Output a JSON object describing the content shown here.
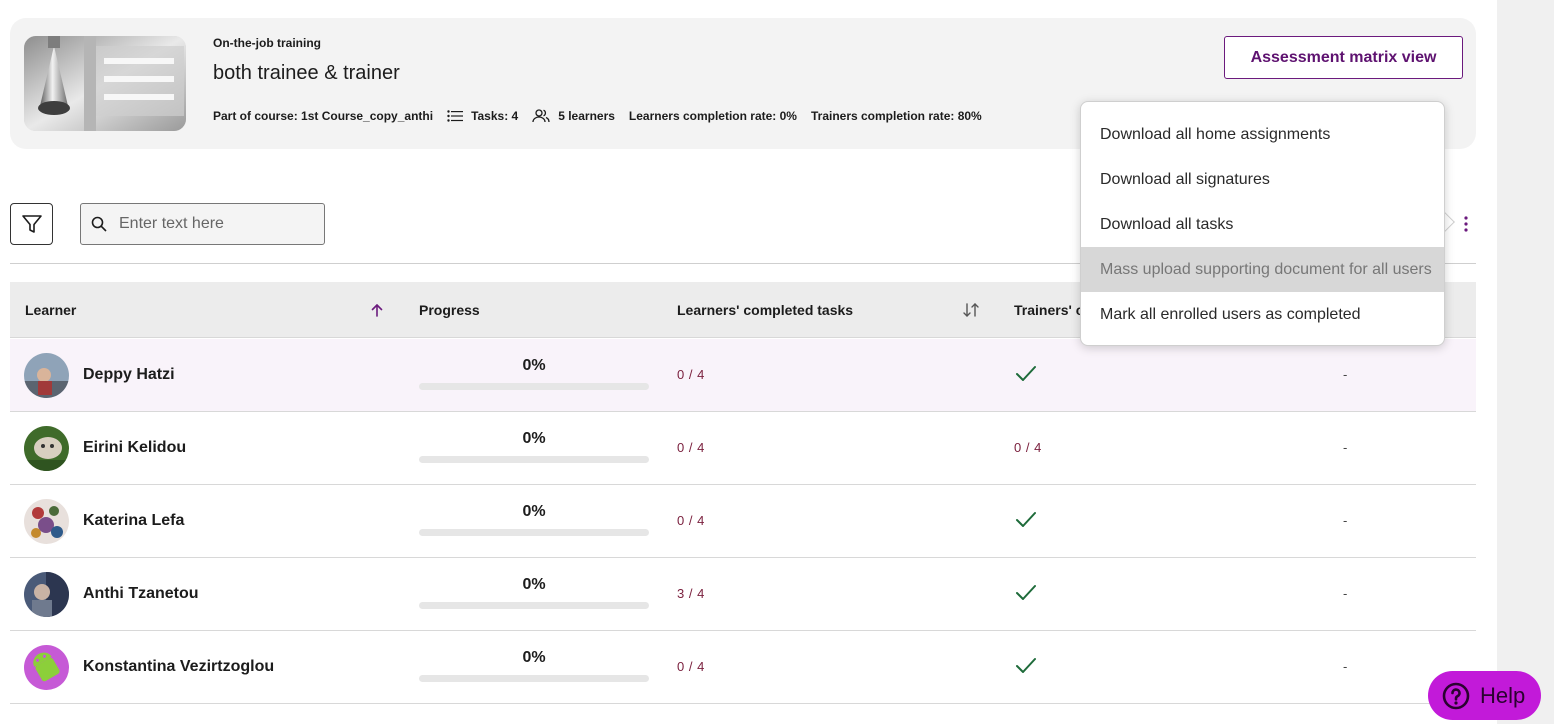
{
  "header": {
    "kicker": "On-the-job training",
    "title": "both trainee & trainer",
    "meta": {
      "course": "Part of course: 1st Course_copy_anthi",
      "tasks": "Tasks: 4",
      "learners": "5 learners",
      "learners_rate": "Learners completion rate: 0%",
      "trainers_rate": "Trainers completion rate: 80%"
    },
    "matrix_button": "Assessment matrix view"
  },
  "toolbar": {
    "search_placeholder": "Enter text here"
  },
  "table": {
    "columns": {
      "learner": "Learner",
      "progress": "Progress",
      "learners_completed": "Learners' completed tasks",
      "trainers_completed": "Trainers' c"
    },
    "rows": [
      {
        "name": "Deppy Hatzi",
        "progress_label": "0%",
        "progress": 0,
        "learners_tasks": "0 / 4",
        "trainers": "check",
        "last": "-"
      },
      {
        "name": "Eirini Kelidou",
        "progress_label": "0%",
        "progress": 0,
        "learners_tasks": "0 / 4",
        "trainers": "0 / 4",
        "last": "-"
      },
      {
        "name": "Katerina Lefa",
        "progress_label": "0%",
        "progress": 0,
        "learners_tasks": "0 / 4",
        "trainers": "check",
        "last": "-"
      },
      {
        "name": "Anthi Tzanetou",
        "progress_label": "0%",
        "progress": 0,
        "learners_tasks": "3 / 4",
        "trainers": "check",
        "last": "-"
      },
      {
        "name": "Konstantina Vezirtzoglou",
        "progress_label": "0%",
        "progress": 0,
        "learners_tasks": "0 / 4",
        "trainers": "check",
        "last": "-"
      }
    ]
  },
  "menu": {
    "items": [
      "Download all home assignments",
      "Download all signatures",
      "Download all tasks",
      "Mass upload supporting document for all users",
      "Mark all enrolled users as completed"
    ]
  },
  "help": {
    "label": "Help"
  },
  "colors": {
    "accent": "#6b1a7d",
    "fraction": "#7a1f3d",
    "check": "#1e6b3a",
    "help_bg": "#c21ad9"
  }
}
